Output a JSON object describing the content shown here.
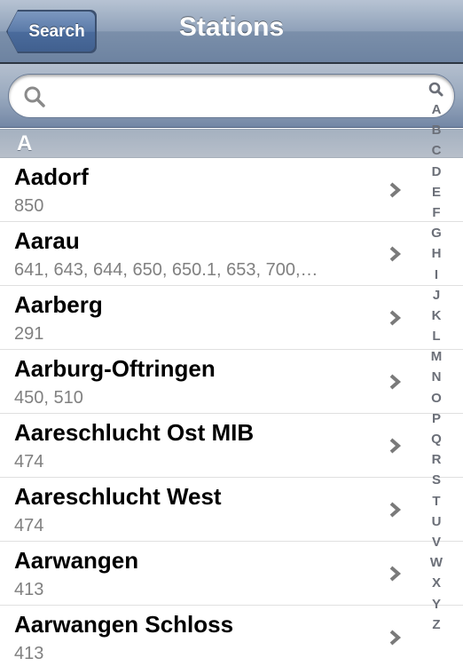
{
  "navbar": {
    "back_label": "Search",
    "title": "Stations"
  },
  "search": {
    "value": "",
    "placeholder": "",
    "icon": "search-icon"
  },
  "section": {
    "letter": "A"
  },
  "stations": [
    {
      "name": "Aadorf",
      "lines": "850"
    },
    {
      "name": "Aarau",
      "lines": "641, 643, 644, 650, 650.1, 653, 700,…"
    },
    {
      "name": "Aarberg",
      "lines": "291"
    },
    {
      "name": "Aarburg-Oftringen",
      "lines": "450, 510"
    },
    {
      "name": "Aareschlucht Ost MIB",
      "lines": "474"
    },
    {
      "name": "Aareschlucht West",
      "lines": "474"
    },
    {
      "name": "Aarwangen",
      "lines": "413"
    },
    {
      "name": "Aarwangen Schloss",
      "lines": "413"
    }
  ],
  "index": {
    "search_icon": "search-icon",
    "letters": [
      "A",
      "B",
      "C",
      "D",
      "E",
      "F",
      "G",
      "H",
      "I",
      "J",
      "K",
      "L",
      "M",
      "N",
      "O",
      "P",
      "Q",
      "R",
      "S",
      "T",
      "U",
      "V",
      "W",
      "X",
      "Y",
      "Z"
    ]
  },
  "colors": {
    "navbar": "#8fa1b9",
    "back_button": "#4a6b9c",
    "subtitle_gray": "#808080",
    "index_gray": "#6b6f78"
  }
}
